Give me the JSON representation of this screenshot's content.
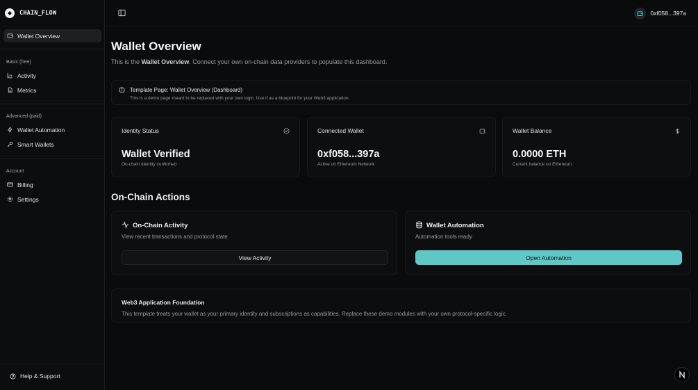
{
  "brand": {
    "name": "CHAIN_FLOW"
  },
  "sidebar": {
    "top_item": {
      "label": "Wallet Overview",
      "icon": "wallet-icon"
    },
    "sections": [
      {
        "label": "Basic (free)",
        "items": [
          {
            "label": "Activity",
            "icon": "bar-chart-icon"
          },
          {
            "label": "Metrics",
            "icon": "file-text-icon"
          }
        ]
      },
      {
        "label": "Advanced (paid)",
        "items": [
          {
            "label": "Wallet Automation",
            "icon": "lightning-icon"
          },
          {
            "label": "Smart Wallets",
            "icon": "key-icon"
          }
        ]
      },
      {
        "label": "Account",
        "items": [
          {
            "label": "Billing",
            "icon": "credit-card-icon"
          },
          {
            "label": "Settings",
            "icon": "gear-icon"
          }
        ]
      }
    ],
    "help": {
      "label": "Help & Support",
      "icon": "help-circle-icon"
    }
  },
  "header": {
    "wallet_address": "0xf058...397a",
    "wallet_icon": "wallet-icon",
    "toggle_icon": "sidebar-toggle-icon"
  },
  "main": {
    "title": "Wallet Overview",
    "subtitle_prefix": "This is the ",
    "subtitle_bold": "Wallet Overview",
    "subtitle_suffix": ". Connect your own on-chain data providers to populate this dashboard.",
    "notice": {
      "title": "Template Page: Wallet Overview (Dashboard)",
      "description": "This is a demo page meant to be replaced with your own logic. Use it as a blueprint for your Web3 application.",
      "icon": "info-icon"
    },
    "stats": [
      {
        "title": "Identity Status",
        "value": "Wallet Verified",
        "sub": "On-chain identity confirmed",
        "icon": "check-circle-icon"
      },
      {
        "title": "Connected Wallet",
        "value": "0xf058...397a",
        "sub": "Active on Ethereum Network",
        "icon": "wallet-icon"
      },
      {
        "title": "Wallet Balance",
        "value": "0.0000 ETH",
        "sub": "Current balance on Ethereum",
        "icon": "dollar-icon"
      }
    ],
    "actions_title": "On-Chain Actions",
    "actions": [
      {
        "title": "On-Chain Activity",
        "description": "View recent transactions and protocol state",
        "button": "View Activity",
        "icon": "activity-icon"
      },
      {
        "title": "Wallet Automation",
        "description": "Automation tools ready",
        "button": "Open Automation",
        "icon": "database-icon"
      }
    ],
    "foundation": {
      "title": "Web3 Application Foundation",
      "description": "This template treats your wallet as your primary identity and subscriptions as capabilities. Replace these demo modules with your own protocol-specific logic."
    }
  },
  "badge": {
    "letter": "N"
  },
  "colors": {
    "accent": "#5fc7c5",
    "background": "#0a0b0c"
  }
}
